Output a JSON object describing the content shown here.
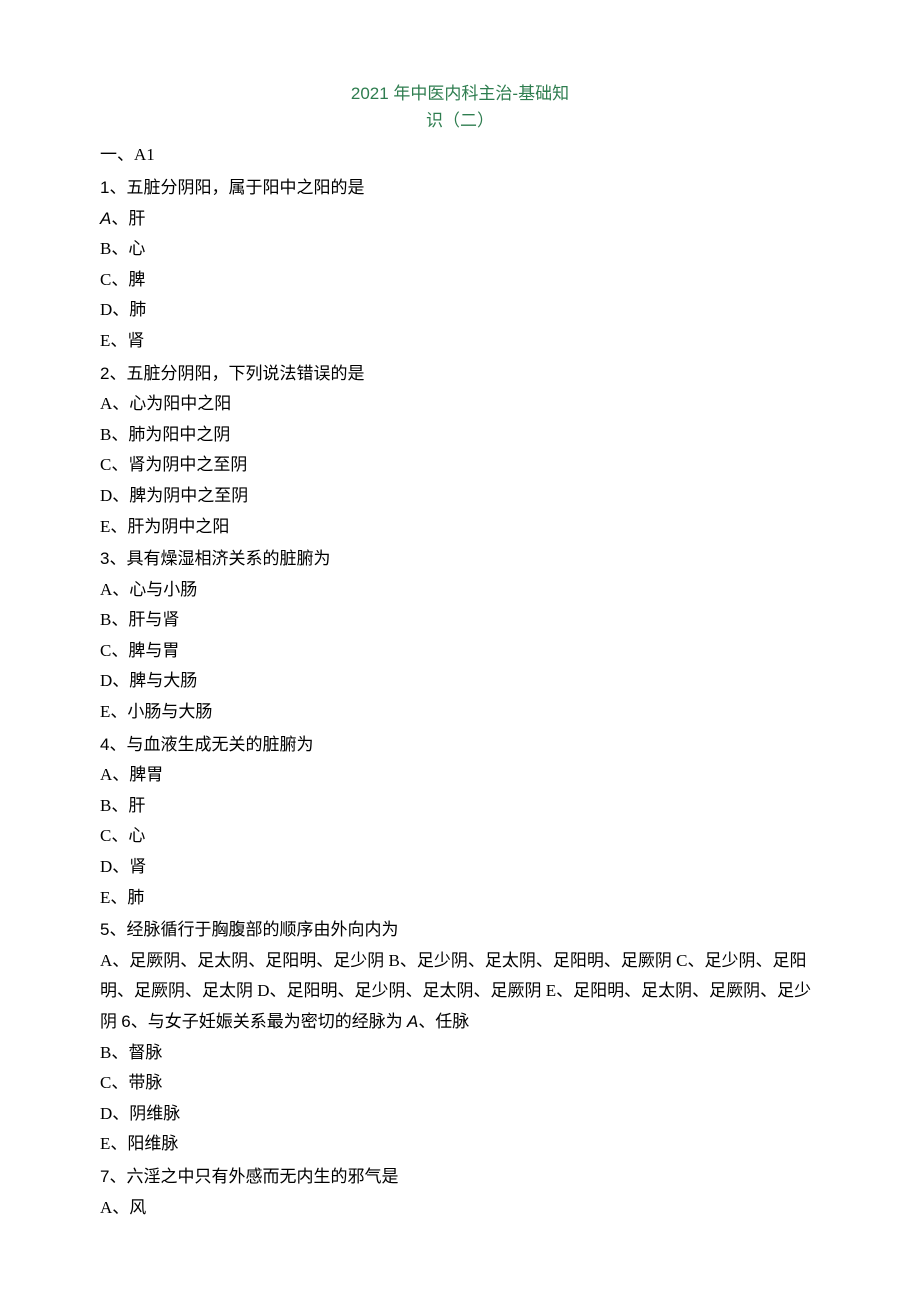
{
  "title": {
    "line1": "2021 年中医内科主治-基础知",
    "line2": "识（二）"
  },
  "section_label": "一、A1",
  "questions": [
    {
      "num": "1",
      "text": "、五脏分阴阳，属于阳中之阳的是",
      "options": [
        {
          "letter": "A",
          "bold": true,
          "text": "、肝"
        },
        {
          "letter": "B",
          "bold": false,
          "text": "、心"
        },
        {
          "letter": "C",
          "bold": false,
          "text": "、脾"
        },
        {
          "letter": "D",
          "bold": false,
          "text": "、肺"
        },
        {
          "letter": "E",
          "bold": false,
          "text": "、肾"
        }
      ]
    },
    {
      "num": "2",
      "text": "、五脏分阴阳，下列说法错误的是",
      "options": [
        {
          "letter": "A",
          "bold": false,
          "text": "、心为阳中之阳"
        },
        {
          "letter": "B",
          "bold": false,
          "text": "、肺为阳中之阴"
        },
        {
          "letter": "C",
          "bold": false,
          "text": "、肾为阴中之至阴"
        },
        {
          "letter": "D",
          "bold": false,
          "text": "、脾为阴中之至阴"
        },
        {
          "letter": "E",
          "bold": false,
          "text": "、肝为阴中之阳"
        }
      ]
    },
    {
      "num": "3",
      "text": "、具有燥湿相济关系的脏腑为",
      "options": [
        {
          "letter": "A",
          "bold": false,
          "text": "、心与小肠"
        },
        {
          "letter": "B",
          "bold": false,
          "text": "、肝与肾"
        },
        {
          "letter": "C",
          "bold": false,
          "text": "、脾与胃"
        },
        {
          "letter": "D",
          "bold": false,
          "text": "、脾与大肠"
        },
        {
          "letter": "E",
          "bold": false,
          "text": "、小肠与大肠"
        }
      ]
    },
    {
      "num": "4",
      "text": "、与血液生成无关的脏腑为",
      "options": [
        {
          "letter": "A",
          "bold": false,
          "text": "、脾胃"
        },
        {
          "letter": "B",
          "bold": false,
          "text": "、肝"
        },
        {
          "letter": "C",
          "bold": false,
          "text": "、心"
        },
        {
          "letter": "D",
          "bold": false,
          "text": "、肾"
        },
        {
          "letter": "E",
          "bold": false,
          "text": "、肺"
        }
      ]
    }
  ],
  "flow_q5_q6": {
    "q5_num": "5",
    "q5_text": "、经脉循行于胸腹部的顺序由外向内为",
    "body": "A、足厥阴、足太阴、足阳明、足少阴 B、足少阴、足太阴、足阳明、足厥阴 C、足少阴、足阳明、足厥阴、足太阴 D、足阳明、足少阴、足太阴、足厥阴 E、足阳明、足太阴、足厥阴、足少阴 ",
    "q6_num": "6",
    "q6_text": "、与女子妊娠关系最为密切的经脉为 ",
    "q6_A_letter": "A",
    "q6_A_text": "、任脉",
    "q6_rest": [
      {
        "letter": "B",
        "text": "、督脉"
      },
      {
        "letter": "C",
        "text": "、带脉"
      },
      {
        "letter": "D",
        "text": "、阴维脉"
      },
      {
        "letter": "E",
        "text": "、阳维脉"
      }
    ]
  },
  "q7": {
    "num": "7",
    "text": "、六淫之中只有外感而无内生的邪气是",
    "options": [
      {
        "letter": "A",
        "text": "、风"
      }
    ]
  }
}
